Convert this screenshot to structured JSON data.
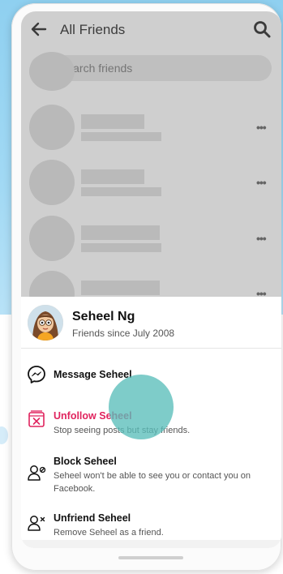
{
  "header": {
    "title": "All Friends"
  },
  "search": {
    "placeholder": "Search friends"
  },
  "friends_list": {
    "more_glyph": "•••"
  },
  "sheet": {
    "name": "Seheel Ng",
    "subtitle": "Friends since July 2008",
    "options": [
      {
        "label": "Message Seheel",
        "desc": "",
        "icon": "messenger-icon"
      },
      {
        "label": "Unfollow Seheel",
        "desc": "Stop seeing posts but stay friends.",
        "icon": "unfollow-icon",
        "label_color": "#e0245e"
      },
      {
        "label": "Block Seheel",
        "desc": "Seheel won't be able to see you or contact you on Facebook.",
        "icon": "block-user-icon"
      },
      {
        "label": "Unfriend Seheel",
        "desc": "Remove Seheel as a friend.",
        "icon": "unfriend-icon"
      }
    ]
  },
  "colors": {
    "background_top": "#a2d9f4",
    "overlay": "#828282",
    "accent_red": "#e0245e",
    "tap_indicator": "#5abeba"
  }
}
